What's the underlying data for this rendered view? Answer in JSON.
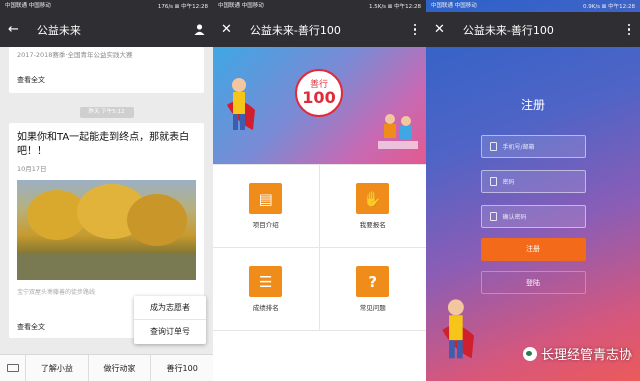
{
  "panel1": {
    "status_left": "中国联通\n中国移动",
    "status_right": "176/s ⊠ 中午12:28",
    "header_title": "公益未来",
    "card1_text": "2017-2018赛季·全国青年公益实践大赛",
    "read_more": "查看全文",
    "time_pill": "昨天 下午5:12",
    "card2_title": "如果你和TA一起能走到终点，那就表白吧！！",
    "card2_date": "10月17日",
    "photo_caption": "宝宁双屋头枣藤善的徒步路线",
    "read_more2": "查看全文",
    "popup_items": [
      "成为志愿者",
      "查询订单号"
    ],
    "menu_items": [
      "了解小益",
      "做行动家",
      "善行100"
    ]
  },
  "panel2": {
    "status_left": "中国联通\n中国移动",
    "status_right": "1.5K/s ⊠ 中午12:28",
    "header_title": "公益未来-善行100",
    "logo_top": "善行",
    "logo_num": "100",
    "tiles": [
      {
        "icon": "▤",
        "label": "项目介绍"
      },
      {
        "icon": "✋",
        "label": "我要报名"
      },
      {
        "icon": "☰",
        "label": "成绩排名"
      },
      {
        "icon": "?",
        "label": "常见问题"
      }
    ]
  },
  "panel3": {
    "status_left": "中国联通\n中国移动",
    "status_right": "0.9K/s ⊠ 中午12:28",
    "header_title": "公益未来-善行100",
    "register_title": "注册",
    "field_phone": "手机号/邮箱",
    "field_password": "密码",
    "field_confirm": "确认密码",
    "btn_register": "注册",
    "btn_login": "登陆",
    "watermark": "长理经管青志协"
  },
  "colors": {
    "accent": "#f08c1a",
    "header": "#2f2f33",
    "register": "#f26a1a"
  }
}
